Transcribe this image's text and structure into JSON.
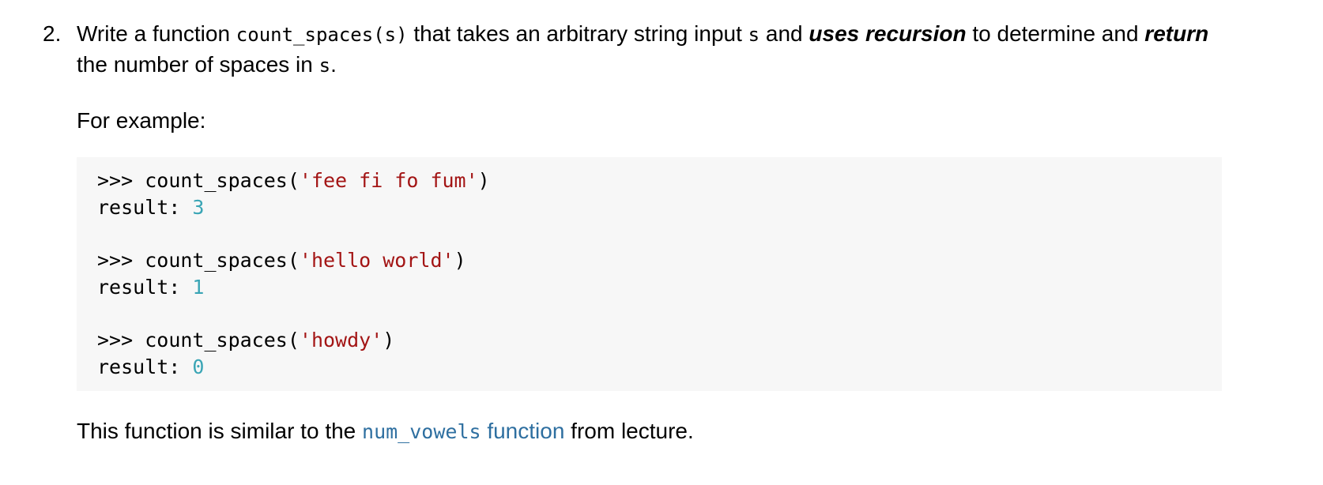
{
  "problem": {
    "number": "2.",
    "intro": {
      "t1": "Write a function ",
      "code1": "count_spaces(s)",
      "t2": " that takes an arbitrary string input ",
      "code2": "s",
      "t3": " and ",
      "bold1": "uses recursion",
      "t4": " to determine and ",
      "bold2": "return",
      "t5": " the number of spaces in ",
      "code3": "s",
      "t6": "."
    },
    "example_label": "For example:",
    "examples": [
      {
        "prompt": ">>> ",
        "call": "count_spaces(",
        "arg": "'fee fi fo fum'",
        "close": ")",
        "result_label": "result: ",
        "result": "3"
      },
      {
        "prompt": ">>> ",
        "call": "count_spaces(",
        "arg": "'hello world'",
        "close": ")",
        "result_label": "result: ",
        "result": "1"
      },
      {
        "prompt": ">>> ",
        "call": "count_spaces(",
        "arg": "'howdy'",
        "close": ")",
        "result_label": "result: ",
        "result": "0"
      }
    ],
    "note": {
      "t1": "This function is similar to the ",
      "link_code": "num_vowels",
      "link_text": " function",
      "t2": " from lecture."
    },
    "colors": {
      "string": "#a31515",
      "number": "#3aa5b5",
      "link": "#2e6fa0",
      "code_bg": "#f7f7f7"
    }
  }
}
